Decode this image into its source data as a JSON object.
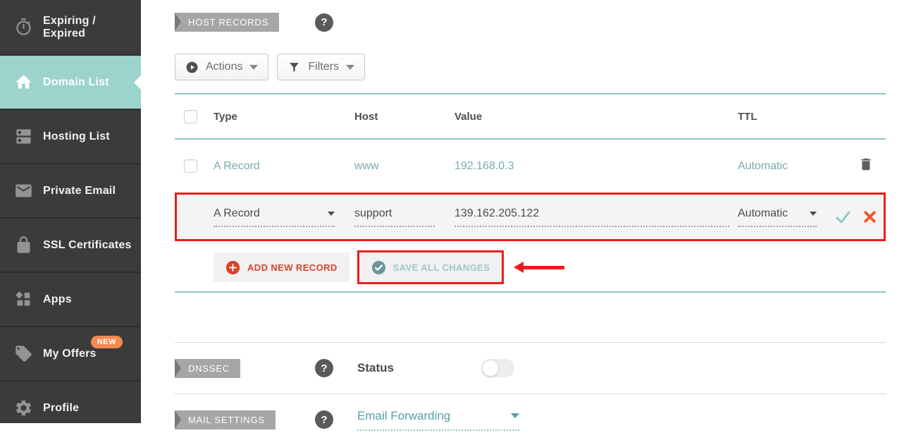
{
  "sidebar": {
    "items": [
      {
        "label": "Expiring / Expired",
        "icon": "stopwatch-icon"
      },
      {
        "label": "Domain List",
        "icon": "home-icon",
        "active": true
      },
      {
        "label": "Hosting List",
        "icon": "server-icon"
      },
      {
        "label": "Private Email",
        "icon": "envelope-icon"
      },
      {
        "label": "SSL Certificates",
        "icon": "lock-icon"
      },
      {
        "label": "Apps",
        "icon": "apps-icon"
      },
      {
        "label": "My Offers",
        "icon": "tag-icon",
        "badge": "NEW"
      },
      {
        "label": "Profile",
        "icon": "gear-icon"
      }
    ]
  },
  "host_records": {
    "section_label": "HOST RECORDS",
    "help_label": "?",
    "toolbar": {
      "actions": "Actions",
      "filters": "Filters"
    },
    "table": {
      "columns": {
        "type": "Type",
        "host": "Host",
        "value": "Value",
        "ttl": "TTL"
      },
      "rows": [
        {
          "type": "A Record",
          "host": "www",
          "value": "192.168.0.3",
          "ttl": "Automatic"
        }
      ],
      "edit_row": {
        "type": "A Record",
        "host": "support",
        "value": "139.162.205.122",
        "ttl": "Automatic"
      }
    },
    "buttons": {
      "add": "ADD NEW RECORD",
      "save": "SAVE ALL CHANGES"
    }
  },
  "dnssec": {
    "section_label": "DNSSEC",
    "help_label": "?",
    "status_label": "Status",
    "status_enabled": false
  },
  "mail_settings": {
    "section_label": "MAIL SETTINGS",
    "help_label": "?",
    "selected_option": "Email Forwarding"
  },
  "colors": {
    "accent_teal": "#8ec6c1",
    "sidebar_active_teal": "#9cd3cc",
    "highlight_red": "#ec1c1c",
    "action_red": "#d8432c",
    "record_link_teal": "#7aa9b2",
    "badge_orange": "#f68950"
  }
}
